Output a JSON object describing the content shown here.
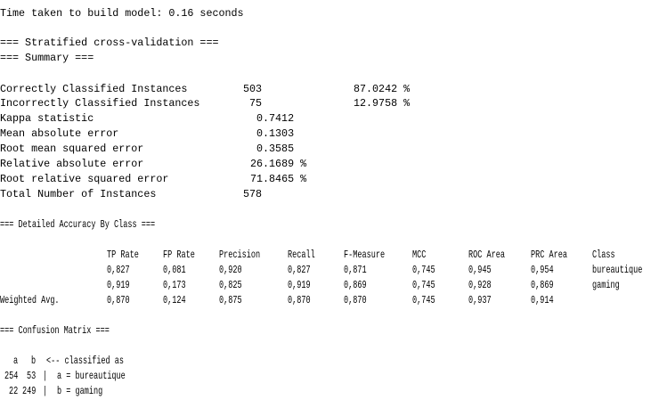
{
  "build_time": "Time taken to build model: 0.16 seconds",
  "headers": {
    "cv": "=== Stratified cross-validation ===",
    "summary": "=== Summary ===",
    "detailed": "=== Detailed Accuracy By Class ===",
    "confusion": "=== Confusion Matrix ==="
  },
  "summary": {
    "correct": {
      "label": "Correctly Classified Instances",
      "value": "503",
      "pct": "87.0242 %"
    },
    "incorrect": {
      "label": "Incorrectly Classified Instances",
      "value": "75",
      "pct": "12.9758 %"
    },
    "kappa": {
      "label": "Kappa statistic",
      "value": "0.7412"
    },
    "mae": {
      "label": "Mean absolute error",
      "value": "0.1303"
    },
    "rmse": {
      "label": "Root mean squared error",
      "value": "0.3585"
    },
    "rae": {
      "label": "Relative absolute error",
      "value": "26.1689 %"
    },
    "rrse": {
      "label": "Root relative squared error",
      "value": "71.8465 %"
    },
    "total": {
      "label": "Total Number of Instances",
      "value": "578"
    }
  },
  "accuracy_table": {
    "columns": [
      "TP Rate",
      "FP Rate",
      "Precision",
      "Recall",
      "F-Measure",
      "MCC",
      "ROC Area",
      "PRC Area",
      "Class"
    ],
    "rows": [
      {
        "label": "",
        "cells": [
          "0,827",
          "0,081",
          "0,920",
          "0,827",
          "0,871",
          "0,745",
          "0,945",
          "0,954",
          "bureautique"
        ]
      },
      {
        "label": "",
        "cells": [
          "0,919",
          "0,173",
          "0,825",
          "0,919",
          "0,869",
          "0,745",
          "0,928",
          "0,869",
          "gaming"
        ]
      },
      {
        "label": "Weighted Avg.",
        "cells": [
          "0,870",
          "0,124",
          "0,875",
          "0,870",
          "0,870",
          "0,745",
          "0,937",
          "0,914",
          ""
        ]
      }
    ]
  },
  "confusion_matrix": {
    "col_a": "a",
    "col_b": "b",
    "header_note": "<-- classified as",
    "rows": [
      {
        "a": "254",
        "b": "53",
        "sep": "|",
        "label": "a = bureautique"
      },
      {
        "a": "22",
        "b": "249",
        "sep": "|",
        "label": "b = gaming"
      }
    ]
  }
}
